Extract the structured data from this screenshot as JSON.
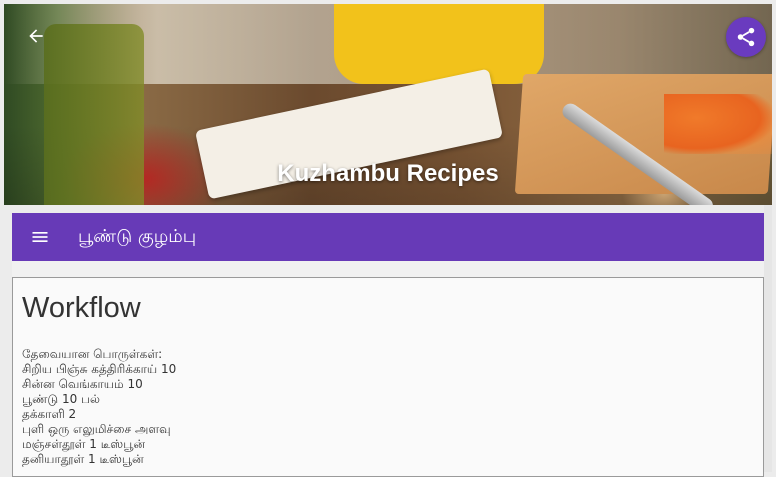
{
  "header": {
    "title": "Kuzhambu Recipes",
    "back_icon": "arrow-left-icon",
    "share_icon": "share-icon"
  },
  "toolbar": {
    "menu_icon": "menu-icon",
    "title": "பூண்டு குழம்பு",
    "color": "#673ab7"
  },
  "card": {
    "heading": "Workflow",
    "lines": [
      "தேவையான பொருள்கள்:",
      "சிறிய பிஞ்சு கத்திரிக்காய் 10",
      "சின்ன வெங்காயம் 10",
      "பூண்டு 10 பல்",
      "தக்காளி 2",
      "புளி ஒரு எலுமிச்சை அளவு",
      "மஞ்சள்தூள் 1 டீஸ்பூன்",
      "தனியாதூள் 1 டீஸ்பூன்"
    ]
  },
  "colors": {
    "accent": "#673ab7",
    "share_fab": "#6a3bbf"
  }
}
